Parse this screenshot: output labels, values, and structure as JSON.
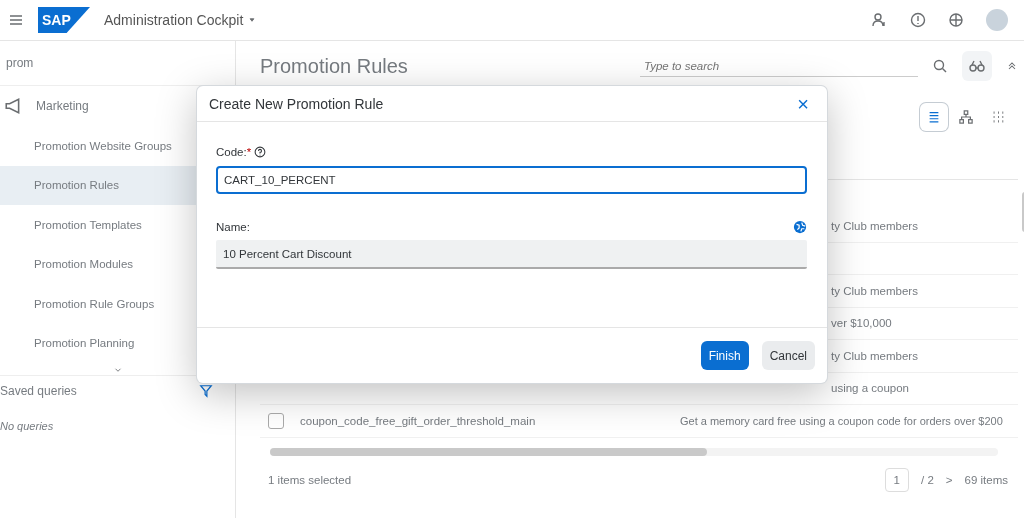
{
  "header": {
    "logo_text": "SAP",
    "app_title": "Administration Cockpit"
  },
  "sidebar": {
    "search_value": "prom",
    "group": {
      "label": "Marketing",
      "children": [
        {
          "label": "Promotion Website Groups",
          "selected": false
        },
        {
          "label": "Promotion Rules",
          "selected": true
        },
        {
          "label": "Promotion Templates",
          "selected": false
        },
        {
          "label": "Promotion Modules",
          "selected": false
        },
        {
          "label": "Promotion Rule Groups",
          "selected": false
        },
        {
          "label": "Promotion Planning",
          "selected": false
        }
      ]
    },
    "saved_queries": {
      "title": "Saved queries",
      "empty_text": "No queries"
    }
  },
  "main": {
    "title": "Promotion Rules",
    "search": {
      "placeholder": "Type to search"
    },
    "views": [
      {
        "kind": "list",
        "selected": true
      },
      {
        "kind": "tree",
        "selected": false
      },
      {
        "kind": "grid",
        "selected": false
      }
    ],
    "rows": [
      {
        "kind": "fragment",
        "description": "ty Club members"
      },
      {
        "kind": "fragment"
      },
      {
        "kind": "fragment",
        "description": "ty Club members"
      },
      {
        "kind": "fragment",
        "description": "ver $10,000"
      },
      {
        "kind": "fragment",
        "description": "ty Club members"
      },
      {
        "kind": "fragment",
        "description": "using a coupon"
      },
      {
        "kind": "full",
        "checked": false,
        "code": "coupon_code_free_gift_order_threshold_main",
        "description": "Get a memory card free using a coupon code for orders over $200"
      }
    ],
    "footer": {
      "selection": "1 items selected",
      "page": "1",
      "pages": "/ 2",
      "next": ">",
      "total": "69 items"
    }
  },
  "dialog": {
    "title": "Create New Promotion Rule",
    "close": "×",
    "code": {
      "label": "Code:",
      "required_mark": "*",
      "value": "CART_10_PERCENT"
    },
    "name": {
      "label": "Name:",
      "value": "10 Percent Cart Discount"
    },
    "buttons": [
      {
        "kind": "primary",
        "label": "Finish"
      },
      {
        "kind": "secondary",
        "label": "Cancel"
      }
    ]
  }
}
